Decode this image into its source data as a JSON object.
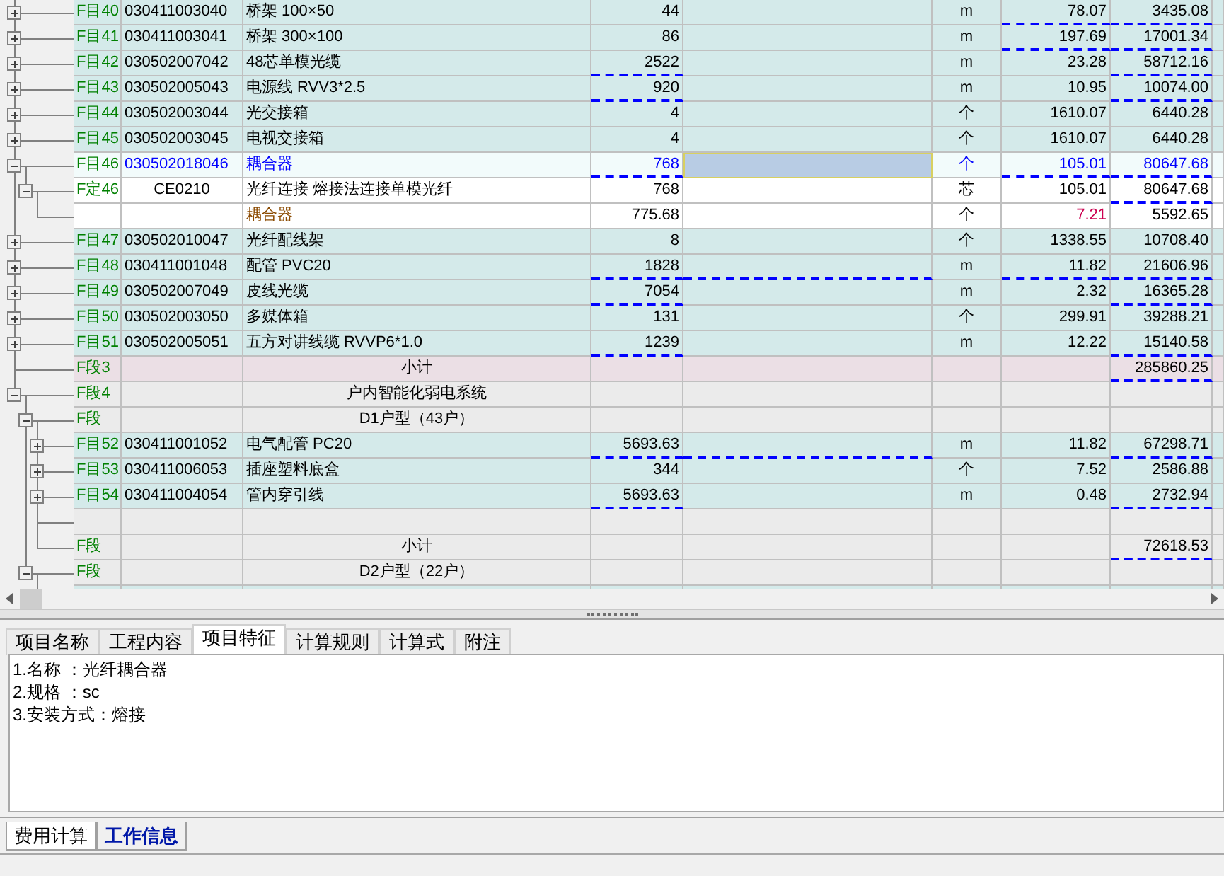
{
  "grid": {
    "rows": [
      {
        "kind": "item",
        "tag": "F目40",
        "code": "030411003040",
        "name": "桥架 100×50",
        "qty": "44",
        "unit": "m",
        "price": "78.07",
        "total": "3435.08",
        "expanded": false,
        "selected": false,
        "qty_marked": false,
        "col6_marked": false,
        "price_marked": true,
        "total_marked": true
      },
      {
        "kind": "item",
        "tag": "F目41",
        "code": "030411003041",
        "name": "桥架 300×100",
        "qty": "86",
        "unit": "m",
        "price": "197.69",
        "total": "17001.34",
        "expanded": false,
        "selected": false,
        "qty_marked": false,
        "col6_marked": false,
        "price_marked": true,
        "total_marked": true
      },
      {
        "kind": "item",
        "tag": "F目42",
        "code": "030502007042",
        "name": "48芯单模光缆",
        "qty": "2522",
        "unit": "m",
        "price": "23.28",
        "total": "58712.16",
        "expanded": false,
        "selected": false,
        "qty_marked": true,
        "col6_marked": false,
        "price_marked": false,
        "total_marked": true
      },
      {
        "kind": "item",
        "tag": "F目43",
        "code": "030502005043",
        "name": "电源线 RVV3*2.5",
        "qty": "920",
        "unit": "m",
        "price": "10.95",
        "total": "10074.00",
        "expanded": false,
        "selected": false,
        "qty_marked": true,
        "col6_marked": false,
        "price_marked": false,
        "total_marked": true
      },
      {
        "kind": "item",
        "tag": "F目44",
        "code": "030502003044",
        "name": "光交接箱",
        "qty": "4",
        "unit": "个",
        "price": "1610.07",
        "total": "6440.28",
        "expanded": false,
        "selected": false,
        "qty_marked": false,
        "col6_marked": false,
        "price_marked": false,
        "total_marked": false
      },
      {
        "kind": "item",
        "tag": "F目45",
        "code": "030502003045",
        "name": "电视交接箱",
        "qty": "4",
        "unit": "个",
        "price": "1610.07",
        "total": "6440.28",
        "expanded": false,
        "selected": false,
        "qty_marked": false,
        "col6_marked": false,
        "price_marked": false,
        "total_marked": false
      },
      {
        "kind": "item",
        "tag": "F目46",
        "code": "030502018046",
        "name": "耦合器",
        "qty": "768",
        "unit": "个",
        "price": "105.01",
        "total": "80647.68",
        "expanded": true,
        "selected": true,
        "qty_marked": true,
        "price_marked": true,
        "total_marked": true,
        "children": [
          {
            "kind": "quota",
            "tag": "F定46",
            "code": "CE0210",
            "name": "光纤连接 熔接法连接单模光纤",
            "qty": "768",
            "unit": "芯",
            "price": "105.01",
            "total": "80647.68",
            "expanded": true,
            "selected": false,
            "qty_marked": false,
            "col6_marked": false,
            "price_marked": false,
            "total_marked": true,
            "children": [
              {
                "kind": "material",
                "name": "耦合器",
                "qty": "775.68",
                "unit": "个",
                "price": "7.21",
                "total": "5592.65",
                "selected": false,
                "qty_marked": false,
                "col6_marked": false,
                "price_marked": false,
                "total_marked": false
              }
            ]
          }
        ]
      },
      {
        "kind": "item",
        "tag": "F目47",
        "code": "030502010047",
        "name": "光纤配线架",
        "qty": "8",
        "unit": "个",
        "price": "1338.55",
        "total": "10708.40",
        "expanded": false,
        "selected": false,
        "qty_marked": false,
        "col6_marked": false,
        "price_marked": false,
        "total_marked": false
      },
      {
        "kind": "item",
        "tag": "F目48",
        "code": "030411001048",
        "name": "配管 PVC20",
        "qty": "1828",
        "unit": "m",
        "price": "11.82",
        "total": "21606.96",
        "expanded": false,
        "selected": false,
        "qty_marked": true,
        "col6_marked": true,
        "price_marked": true,
        "total_marked": true
      },
      {
        "kind": "item",
        "tag": "F目49",
        "code": "030502007049",
        "name": "皮线光缆",
        "qty": "7054",
        "unit": "m",
        "price": "2.32",
        "total": "16365.28",
        "expanded": false,
        "selected": false,
        "qty_marked": true,
        "col6_marked": false,
        "price_marked": false,
        "total_marked": true
      },
      {
        "kind": "item",
        "tag": "F目50",
        "code": "030502003050",
        "name": "多媒体箱",
        "qty": "131",
        "unit": "个",
        "price": "299.91",
        "total": "39288.21",
        "expanded": false,
        "selected": false,
        "qty_marked": false,
        "col6_marked": false,
        "price_marked": false,
        "total_marked": false
      },
      {
        "kind": "item",
        "tag": "F目51",
        "code": "030502005051",
        "name": "五方对讲线缆 RVVP6*1.0",
        "qty": "1239",
        "unit": "m",
        "price": "12.22",
        "total": "15140.58",
        "expanded": false,
        "selected": false,
        "qty_marked": true,
        "col6_marked": false,
        "price_marked": false,
        "total_marked": true
      },
      {
        "kind": "subtotal",
        "tag": "F段3",
        "name": "小计",
        "total": "285860.25",
        "selected": false,
        "total_marked": true
      },
      {
        "kind": "section",
        "tag": "F段4",
        "name": "户内智能化弱电系统",
        "expanded": true,
        "selected": false,
        "children": [
          {
            "kind": "section",
            "tag": "F段",
            "name": "D1户型（43户）",
            "expanded": true,
            "selected": false,
            "children": [
              {
                "kind": "item",
                "tag": "F目52",
                "code": "030411001052",
                "name": "电气配管 PC20",
                "qty": "5693.63",
                "unit": "m",
                "price": "11.82",
                "total": "67298.71",
                "expanded": false,
                "selected": false,
                "qty_marked": true,
                "col6_marked": true,
                "price_marked": false,
                "total_marked": true
              },
              {
                "kind": "item",
                "tag": "F目53",
                "code": "030411006053",
                "name": "插座塑料底盒",
                "qty": "344",
                "unit": "个",
                "price": "7.52",
                "total": "2586.88",
                "expanded": false,
                "selected": false,
                "qty_marked": false,
                "col6_marked": false,
                "price_marked": false,
                "total_marked": false
              },
              {
                "kind": "item",
                "tag": "F目54",
                "code": "030411004054",
                "name": "管内穿引线",
                "qty": "5693.63",
                "unit": "m",
                "price": "0.48",
                "total": "2732.94",
                "expanded": false,
                "selected": false,
                "qty_marked": true,
                "col6_marked": false,
                "price_marked": false,
                "total_marked": true
              },
              {
                "kind": "blank",
                "selected": false
              },
              {
                "kind": "section",
                "tag": "F段",
                "name": "小计",
                "total": "72618.53",
                "selected": false,
                "total_marked": true
              }
            ]
          },
          {
            "kind": "section",
            "tag": "F段",
            "name": "D2户型（22户）",
            "expanded": true,
            "selected": false,
            "children": [
              {
                "kind": "item",
                "selected": false
              }
            ]
          }
        ]
      }
    ]
  },
  "detail_tabs": [
    {
      "label": "项目名称",
      "selected": false
    },
    {
      "label": "工程内容",
      "selected": false
    },
    {
      "label": "项目特征",
      "selected": true
    },
    {
      "label": "计算规则",
      "selected": false
    },
    {
      "label": "计算式",
      "selected": false
    },
    {
      "label": "附注",
      "selected": false
    }
  ],
  "detail_lines": [
    "1.名称 ：光纤耦合器",
    "2.规格 ：sc",
    "3.安装方式：熔接"
  ],
  "bottom_tabs": [
    {
      "label": "费用计算",
      "selected": false
    },
    {
      "label": "工作信息",
      "selected": true
    }
  ]
}
